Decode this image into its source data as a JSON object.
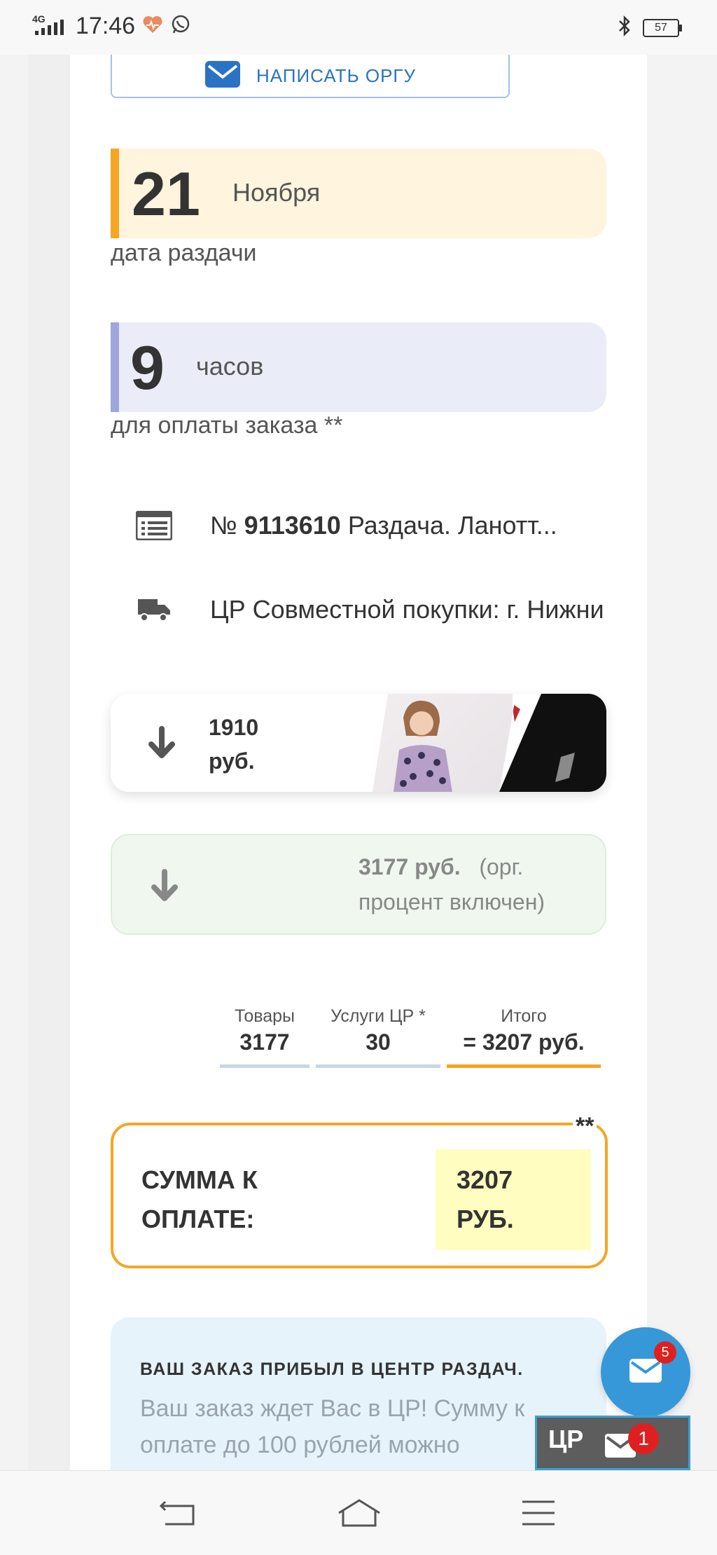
{
  "status_bar": {
    "network": "4G",
    "time": "17:46",
    "battery": "57"
  },
  "contact": {
    "write_label": "НАПИСАТЬ ОРГУ"
  },
  "distribution_date": {
    "day": "21",
    "month": "Ноября",
    "caption": "дата раздачи"
  },
  "payment_time": {
    "hours": "9",
    "unit": "часов",
    "caption": "для оплаты заказа **"
  },
  "order": {
    "number_prefix": "№",
    "number": "9113610",
    "title": "Раздача. Ланотт...",
    "delivery": "ЦР Совместной покупки: г. Нижни"
  },
  "items_card": {
    "price_line1": "1910",
    "price_line2": "руб."
  },
  "total_card": {
    "sum": "3177 руб.",
    "note": "(орг. процент включен)"
  },
  "calc": {
    "goods_label": "Товары",
    "goods_value": "3177",
    "services_label": "Услуги ЦР *",
    "services_value": "30",
    "total_label": "Итого",
    "total_value": "= 3207 руб."
  },
  "payment": {
    "label_line1": "СУММА К",
    "label_line2": "ОПЛАТЕ:",
    "value_line1": "3207",
    "value_line2": "РУБ.",
    "stars": "**"
  },
  "notice": {
    "title": "ВАШ ЗАКАЗ ПРИБЫЛ В ЦЕНТР РАЗДАЧ.",
    "body": "Ваш заказ ждет Вас в ЦР! Сумму к оплате до 100 рублей можно"
  },
  "fab": {
    "badge": "5"
  },
  "cr_widget": {
    "label": "ЦР",
    "badge": "1"
  },
  "colors": {
    "accent_orange": "#f5a623",
    "accent_purple": "#9ea6dc",
    "link_blue": "#2a73c4",
    "fab_blue": "#3698d8",
    "badge_red": "#e02020"
  }
}
